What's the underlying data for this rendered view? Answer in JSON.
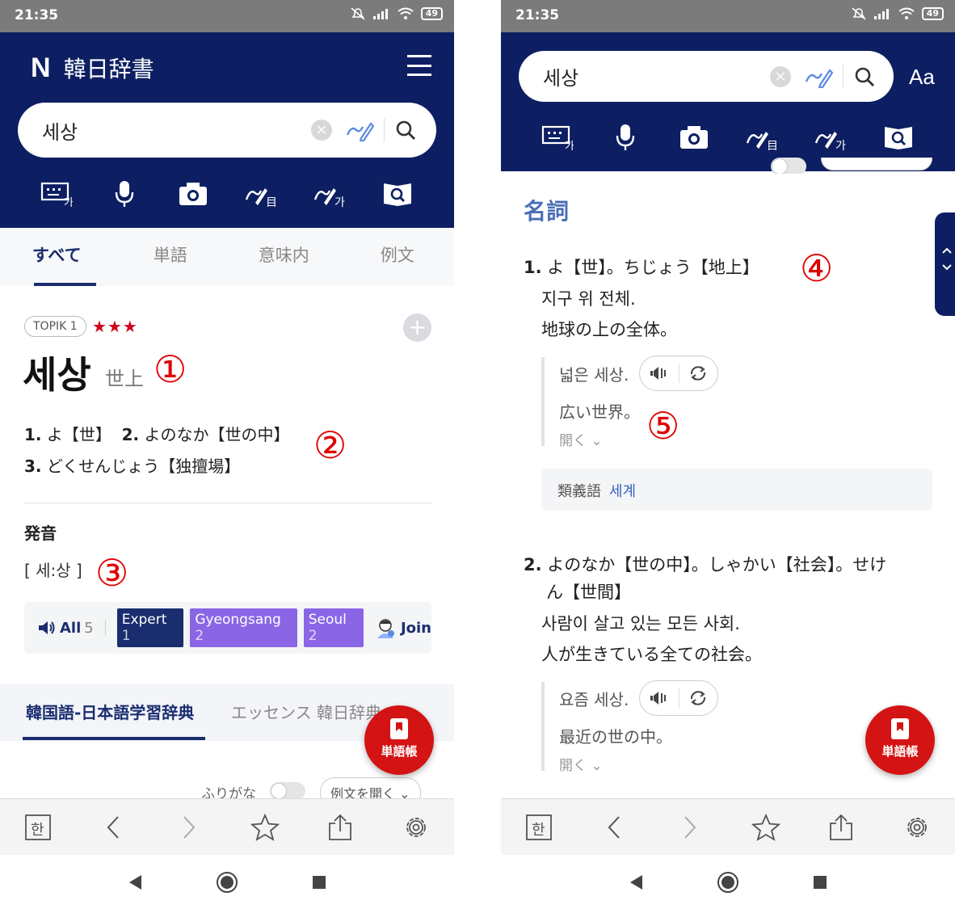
{
  "status": {
    "time": "21:35",
    "battery": "49"
  },
  "app": {
    "logo": "N",
    "title": "韓日辞書"
  },
  "search": {
    "query": "세상"
  },
  "tabs": [
    "すべて",
    "単語",
    "意味内",
    "例文"
  ],
  "entry": {
    "level": "TOPIK 1",
    "stars": "★★★",
    "headword": "세상",
    "hanja": "世上",
    "summary": {
      "n1": "1.",
      "d1": "よ【世】",
      "n2": "2.",
      "d2": "よのなか【世の中】",
      "n3": "3.",
      "d3": "どくせんじょう【独擅場】"
    },
    "pron_heading": "発音",
    "pron": "[ 세:상 ]"
  },
  "audio": {
    "all_label": "All",
    "all_count": "5",
    "tags": [
      {
        "name": "Expert",
        "count": "1",
        "color": "#1a2d6e"
      },
      {
        "name": "Gyeongsang",
        "count": "2",
        "color": "#8a66e6"
      },
      {
        "name": "Seoul",
        "count": "2",
        "color": "#8a66e6"
      }
    ],
    "join": "Join"
  },
  "dict_tabs": [
    "韓国語-日本語学習辞典",
    "エッセンス 韓日辞典"
  ],
  "furigana": "ふりがな",
  "open_examples": "例文を開く",
  "fab": {
    "label": "単語帳"
  },
  "annotations": {
    "a1": "①",
    "a2": "②",
    "a3": "③",
    "a4": "④",
    "a5": "⑤"
  },
  "right": {
    "pos": "名詞",
    "sense1": {
      "num": "1.",
      "ja": "よ【世】。ちじょう【地上】",
      "ko_def": "지구 위 전체.",
      "ja_def": "地球の上の全体。",
      "ex_ko": "넓은 세상.",
      "ex_ja": "広い世界。",
      "open": "開く ⌄"
    },
    "synonym": {
      "label": "類義語",
      "word": "세계"
    },
    "sense2": {
      "num": "2.",
      "ja_line1": "よのなか【世の中】。しゃかい【社会】。せけ",
      "ja_line2": "ん【世間】",
      "ko_def": "사람이 살고 있는 모든 사회.",
      "ja_def": "人が生きている全ての社会。",
      "ex_ko": "요즘 세상.",
      "ex_ja": "最近の世の中。",
      "open": "開く ⌄"
    },
    "aa": "Aa"
  },
  "bottom": {
    "korean_key": "한"
  },
  "colors": {
    "navy": "#0d1f62",
    "accent_red": "#d41414",
    "annotation_red": "#e00000"
  }
}
